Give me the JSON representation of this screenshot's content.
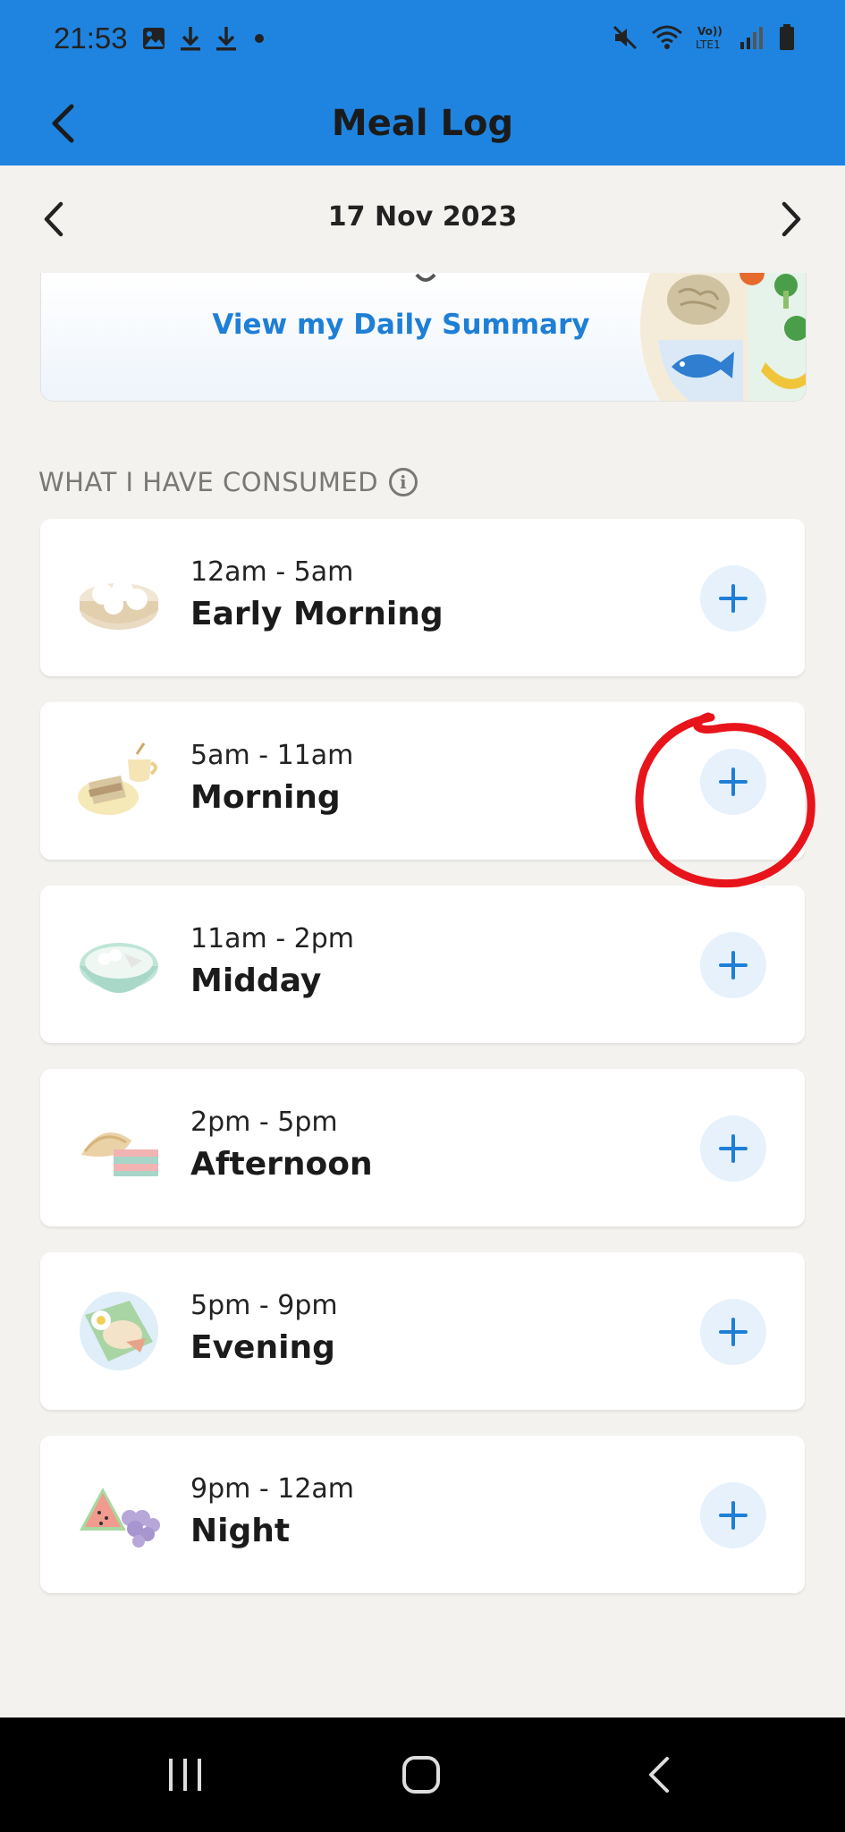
{
  "status": {
    "time": "21:53",
    "left_icons": [
      "image-icon",
      "download-icon",
      "download-icon",
      "dot-icon"
    ],
    "right_icons": [
      "mute-icon",
      "wifi-icon",
      "volte-icon",
      "signal-icon",
      "battery-icon"
    ],
    "volte_label": "Vo))\nLTE1"
  },
  "appbar": {
    "title": "Meal Log"
  },
  "date": {
    "label": "17 Nov 2023"
  },
  "summary": {
    "link": "View my Daily Summary"
  },
  "section": {
    "label": "WHAT I HAVE CONSUMED"
  },
  "meals": [
    {
      "time": "12am - 5am",
      "name": "Early Morning",
      "icon": "dumplings-icon"
    },
    {
      "time": "5am - 11am",
      "name": "Morning",
      "icon": "toast-coffee-icon"
    },
    {
      "time": "11am - 2pm",
      "name": "Midday",
      "icon": "noodle-bowl-icon"
    },
    {
      "time": "2pm - 5pm",
      "name": "Afternoon",
      "icon": "curry-puff-cake-icon"
    },
    {
      "time": "5pm - 9pm",
      "name": "Evening",
      "icon": "nasi-lemak-icon"
    },
    {
      "time": "9pm - 12am",
      "name": "Night",
      "icon": "watermelon-grapes-icon"
    }
  ],
  "colors": {
    "header": "#1f84e0",
    "accent": "#1e7fd6",
    "annotation": "#e8141b",
    "background": "#f3f2ef"
  }
}
